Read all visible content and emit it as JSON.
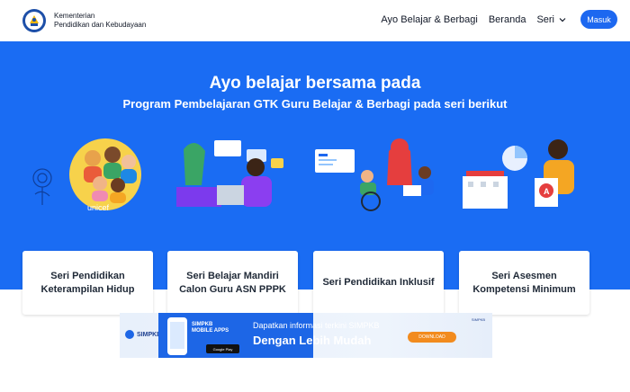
{
  "header": {
    "org_line1": "Kementerian",
    "org_line2": "Pendidikan dan Kebudayaan",
    "nav": {
      "link1": "Ayo Belajar & Berbagi",
      "link2": "Beranda",
      "series": "Seri",
      "login": "Masuk"
    }
  },
  "hero": {
    "title": "Ayo belajar bersama pada",
    "subtitle": "Program Pembelajaran GTK Guru Belajar & Berbagi pada seri berikut",
    "cards": [
      {
        "line1": "Seri Pendidikan",
        "line2": "Keterampilan Hidup"
      },
      {
        "line1": "Seri Belajar Mandiri",
        "line2": "Calon Guru ASN PPPK"
      },
      {
        "line1": "Seri Pendidikan Inklusif",
        "line2": ""
      },
      {
        "line1": "Seri Asesmen",
        "line2": "Kompetensi Minimum"
      }
    ],
    "unicef": "unicef",
    "badge_letter": "A"
  },
  "banner": {
    "logo_text": "SIMPKB",
    "apps_line1": "SIMPKB",
    "apps_line2": "MOBILE APPS",
    "store": "Google Play",
    "text1": "Dapatkan informasi terkini SIMPKB",
    "text2": "Dengan Lebih Mudah",
    "download": "DOWNLOAD",
    "mini_logo": "SIMPKB"
  },
  "colors": {
    "primary": "#1a6cf3",
    "button": "#1d68f0",
    "banner_blue": "#1d66e6",
    "download": "#f28b1e"
  }
}
